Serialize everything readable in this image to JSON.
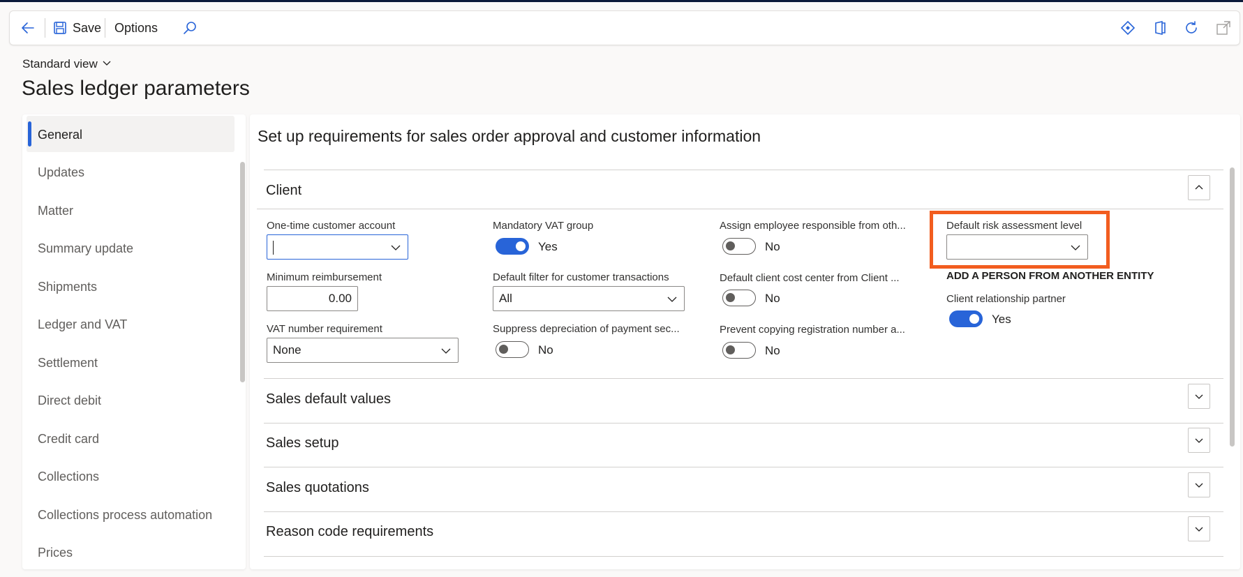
{
  "toolbar": {
    "back_icon": "back-arrow-icon",
    "save_label": "Save",
    "options_label": "Options",
    "search_icon": "search-icon",
    "right_icons": [
      "diamond-icon",
      "office-icon",
      "refresh-icon",
      "open-new-window-icon"
    ]
  },
  "view": {
    "label": "Standard view"
  },
  "page": {
    "title": "Sales ledger parameters"
  },
  "nav": {
    "items": [
      {
        "label": "General"
      },
      {
        "label": "Updates"
      },
      {
        "label": "Matter"
      },
      {
        "label": "Summary update"
      },
      {
        "label": "Shipments"
      },
      {
        "label": "Ledger and VAT"
      },
      {
        "label": "Settlement"
      },
      {
        "label": "Direct debit"
      },
      {
        "label": "Credit card"
      },
      {
        "label": "Collections"
      },
      {
        "label": "Collections process automation"
      },
      {
        "label": "Prices"
      }
    ],
    "selected": "General"
  },
  "main": {
    "heading": "Set up requirements for sales order approval and customer information",
    "client": {
      "title": "Client",
      "one_time_customer_account": {
        "label": "One-time customer account",
        "value": ""
      },
      "minimum_reimbursement": {
        "label": "Minimum reimbursement",
        "value": "0.00"
      },
      "vat_number_requirement": {
        "label": "VAT number requirement",
        "value": "None"
      },
      "mandatory_vat_group": {
        "label": "Mandatory VAT group",
        "value": "Yes"
      },
      "default_filter": {
        "label": "Default filter for customer transactions",
        "value": "All"
      },
      "suppress_depreciation": {
        "label": "Suppress depreciation of payment sec...",
        "value": "No"
      },
      "assign_employee": {
        "label": "Assign employee responsible from oth...",
        "value": "No"
      },
      "default_client_cost_center": {
        "label": "Default client cost center from Client ...",
        "value": "No"
      },
      "prevent_copying": {
        "label": "Prevent copying registration number a...",
        "value": "No"
      },
      "default_risk_level": {
        "label": "Default risk assessment level",
        "value": ""
      },
      "add_person_heading": "ADD A PERSON FROM ANOTHER ENTITY",
      "client_relationship_partner": {
        "label": "Client relationship partner",
        "value": "Yes"
      }
    },
    "sections": [
      {
        "title": "Sales default values"
      },
      {
        "title": "Sales setup"
      },
      {
        "title": "Sales quotations"
      },
      {
        "title": "Reason code requirements"
      }
    ]
  },
  "colors": {
    "accent": "#2864d8",
    "highlight": "#f25d1f"
  }
}
